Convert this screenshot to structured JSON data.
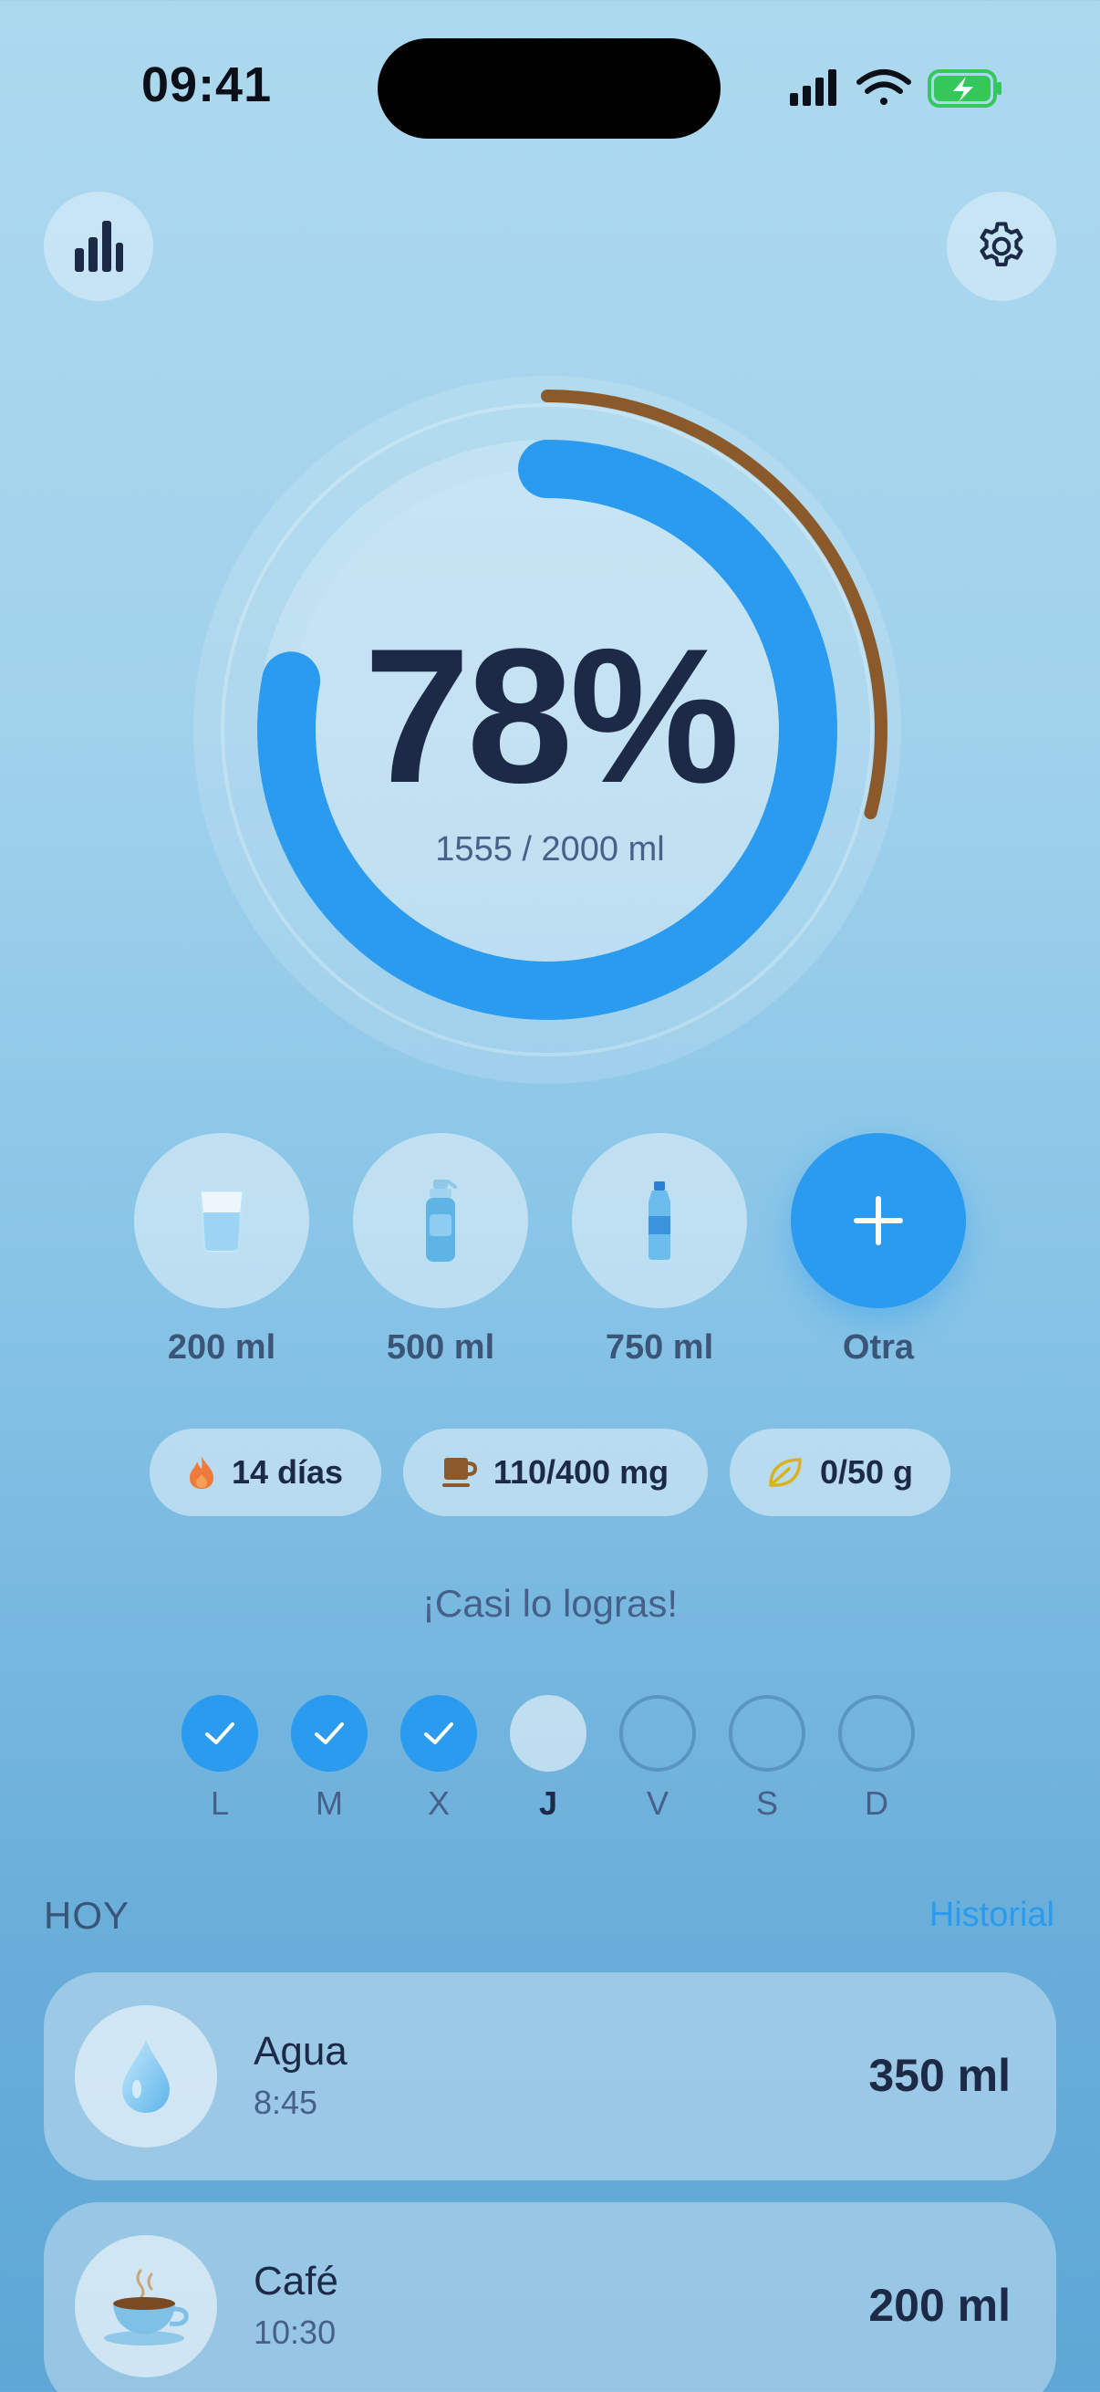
{
  "status_bar": {
    "time": "09:41"
  },
  "progress": {
    "percent_label": "78%",
    "amount_label": "1555 / 2000 ml",
    "fraction": 0.78,
    "outer_fraction": 0.29
  },
  "quick_add": [
    {
      "label": "200 ml",
      "icon": "glass-icon"
    },
    {
      "label": "500 ml",
      "icon": "sport-bottle-icon"
    },
    {
      "label": "750 ml",
      "icon": "water-bottle-icon"
    },
    {
      "label": "Otra",
      "icon": "plus-icon"
    }
  ],
  "stats": {
    "streak": "14 días",
    "caffeine": "110/400 mg",
    "sugar": "0/50 g"
  },
  "message": "¡Casi lo logras!",
  "week": {
    "days": [
      "L",
      "M",
      "X",
      "J",
      "V",
      "S",
      "D"
    ],
    "states": [
      "done",
      "done",
      "done",
      "today",
      "empty",
      "empty",
      "empty"
    ]
  },
  "log": {
    "section_title": "HOY",
    "history_link": "Historial",
    "items": [
      {
        "title": "Agua",
        "time": "8:45",
        "amount": "350 ml",
        "icon": "water-drop-icon"
      },
      {
        "title": "Café",
        "time": "10:30",
        "amount": "200 ml",
        "icon": "coffee-cup-icon"
      }
    ]
  },
  "colors": {
    "accent": "#2a9bef",
    "caffeine_ring": "#8b5a2b",
    "text_dark": "#1c2a48",
    "text_muted": "#46608a"
  }
}
